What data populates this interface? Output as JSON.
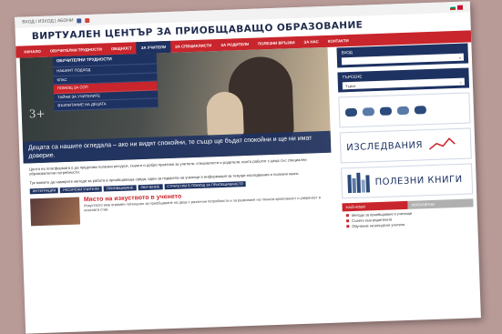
{
  "topbar": {
    "login_text": "ВХОД / ИЗХОД | АБОНИ",
    "social_icons": [
      "facebook-icon",
      "google-plus-icon"
    ],
    "flag_icons": [
      "bg-flag-icon",
      "gb-flag-icon"
    ]
  },
  "site": {
    "title": "ВИРТУАЛЕН ЦЕНТЪР ЗА ПРИОБЩАВАЩО ОБРАЗОВАНИЕ"
  },
  "nav": {
    "items": [
      "НАЧАЛО",
      "ОБУЧИТЕЛНИ ТРУДНОСТИ",
      "ОБЩНОСТ",
      "ЗА УЧИТЕЛИ",
      "ЗА СПЕЦИАЛИСТИ",
      "ЗА РОДИТЕЛИ",
      "ПОЛЕЗНИ ВРЪЗКИ",
      "ЗА НАС",
      "КОНТАКТИ"
    ],
    "active": "ЗА УЧИТЕЛИ"
  },
  "dropdown": {
    "header": "ОБУЧИТЕЛНИ ТРУДНОСТИ",
    "items": [
      "НАШИЯТ ПОДХОД",
      "КЛАС",
      "ПОМОЩ ЗА СОП",
      "ТАЙНИ ЗА УЧИТЕЛИТЕ",
      "ВЪЗПИТАНИЕ НА ДЕЦАТА"
    ],
    "highlighted": "ПОМОЩ ЗА СОП"
  },
  "hero": {
    "chalk": "3+",
    "caption": "Децата са нашите огледала – ако ни видят спокойни, те също ще бъдат спокойни и ще ни имат доверие."
  },
  "intro": {
    "p1": "Целта на платформата е да предложи полезни ресурси, съвети и добри практики за учители, специалисти и родители, които работят с деца със специални образователни потребности.",
    "p2": "Тук можете да намерите методи за работа в приобщаваща среда, идеи за подкрепа на ученици и информация за текущи изследвания и полезни книги."
  },
  "tags": [
    "ИНТЕГРАЦИЯ",
    "РЕСУРСНИ УЧИТЕЛИ",
    "ПРИОБЩАВАНЕ",
    "ОБУЧЕНИЕ",
    "СТРАТЕГИИ В ПОМОЩ ЗА ПРИОБЩАВАНЕТО"
  ],
  "article": {
    "title": "Място на изкуството в ученето",
    "text": "Изкуството има огромен потенциал за приобщаване на деца с различни потребности и за развиване на тяхната креативност и увереност в класната стая."
  },
  "sidebar": {
    "login_label": "ВХОД",
    "search_label": "ТЪРСЕНЕ",
    "search_placeholder": "Търси",
    "banner1_icon": "speech-bubbles-icon",
    "banner2": "ИЗСЛЕДВАНИЯ",
    "banner3": "ПОЛЕЗНИ КНИГИ",
    "tabs": [
      "НАЙ-НОВИ",
      "ПОПУЛЯРНИ"
    ],
    "news": [
      "Методи за приобщаване в училище",
      "Съвети към родителите",
      "Обучение на ресурсни учители"
    ]
  },
  "colors": {
    "brand_blue": "#1e3262",
    "brand_red": "#c9252c"
  }
}
